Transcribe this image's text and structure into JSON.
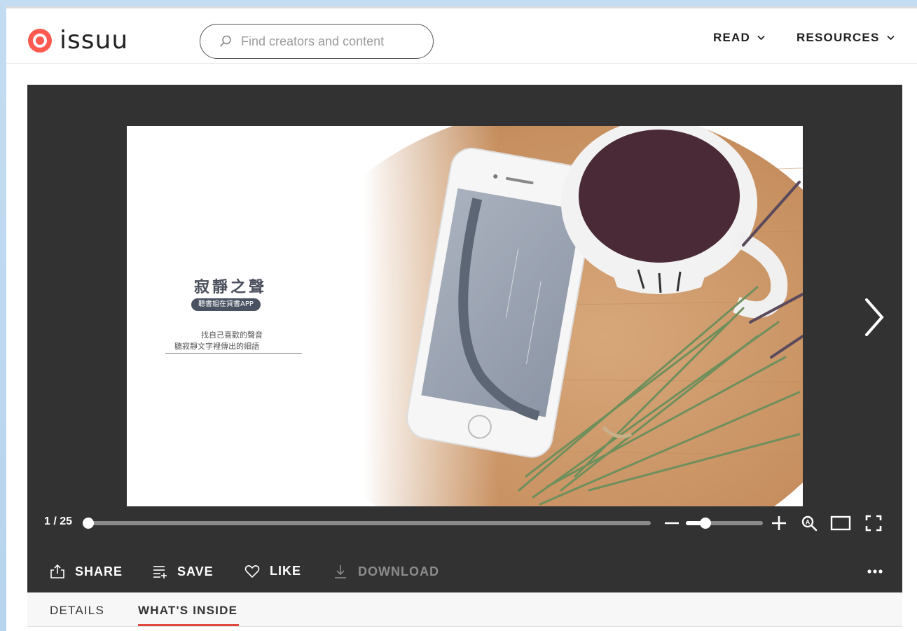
{
  "header": {
    "logo_text": "issuu",
    "search_placeholder": "Find creators and content",
    "nav": [
      {
        "label": "READ"
      },
      {
        "label": "RESOURCES"
      }
    ]
  },
  "reader": {
    "page_counter": "1 / 25",
    "current_page": 1,
    "total_pages": 25,
    "zoom_level_fraction": 0.25,
    "slide": {
      "title": "寂靜之聲",
      "badge": "聽書姐在貸書APP",
      "line1": "找自己喜歡的聲音",
      "line2": "聽寂靜文字裡傳出的細語"
    }
  },
  "actions": {
    "share": "SHARE",
    "save": "SAVE",
    "like": "LIKE",
    "download": "DOWNLOAD"
  },
  "tabs": {
    "details": "DETAILS",
    "whats_inside": "WHAT'S INSIDE",
    "active": "whats_inside"
  },
  "colors": {
    "brand": "#ff5a4f",
    "reader_bg": "#323232",
    "tab_accent": "#e0483e"
  }
}
